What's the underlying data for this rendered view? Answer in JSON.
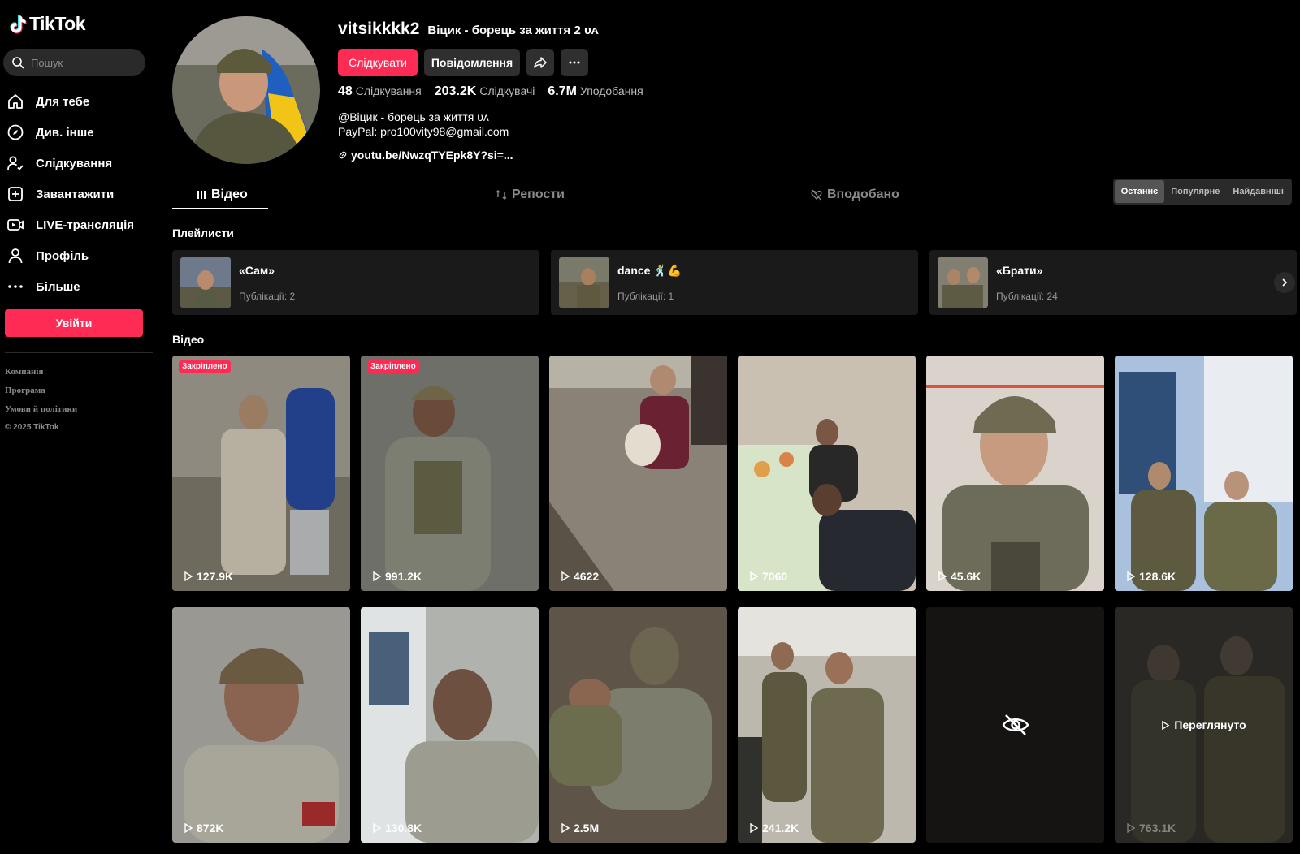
{
  "sidebar": {
    "logo": "TikTok",
    "search_placeholder": "Пошук",
    "nav": [
      "Для тебе",
      "Див. інше",
      "Слідкування",
      "Завантажити",
      "LIVE-трансляція",
      "Профіль",
      "Більше"
    ],
    "login": "Увійти",
    "footer": [
      "Компанія",
      "Програма",
      "Умови й політики"
    ],
    "copyright": "© 2025 TikTok"
  },
  "profile": {
    "username": "vitsikkkk2",
    "nickname": "Віцик - борець за життя 2 ᴜᴀ",
    "follow": "Слідкувати",
    "message": "Повідомлення",
    "stats": [
      {
        "value": "48",
        "label": "Слідкування"
      },
      {
        "value": "203.2K",
        "label": "Слідкувачі"
      },
      {
        "value": "6.7M",
        "label": "Уподобання"
      }
    ],
    "bio_line1": "@Віцик - борець за життя ᴜᴀ",
    "bio_line2": "PayPal: pro100vity98@gmail.com",
    "link": "youtu.be/NwzqTYEpk8Y?si=..."
  },
  "tabs": {
    "videos": "Відео",
    "reposts": "Репости",
    "liked": "Вподобано",
    "sort": [
      "Останнє",
      "Популярне",
      "Найдавніші"
    ]
  },
  "playlists_title": "Плейлисти",
  "playlists": [
    {
      "name": "«Сам»",
      "count": "Публікації: 2"
    },
    {
      "name": "dance 🕺💪",
      "count": "Публікації: 1"
    },
    {
      "name": "«Брати»",
      "count": "Публікації: 24"
    }
  ],
  "videos_title": "Відео",
  "pinned_label": "Закріплено",
  "watched_label": "Переглянуто",
  "videos": [
    {
      "views": "127.9K"
    },
    {
      "views": "991.2K"
    },
    {
      "views": "4622"
    },
    {
      "views": "7060"
    },
    {
      "views": "45.6K"
    },
    {
      "views": "128.6K"
    },
    {
      "views": "872K"
    },
    {
      "views": "130.8K"
    },
    {
      "views": "2.5M"
    },
    {
      "views": "241.2K"
    },
    {
      "views": ""
    },
    {
      "views": "763.1K"
    }
  ],
  "colors": {
    "accent": "#fe2c55",
    "background": "#000000",
    "panel": "#1a1a1a"
  }
}
